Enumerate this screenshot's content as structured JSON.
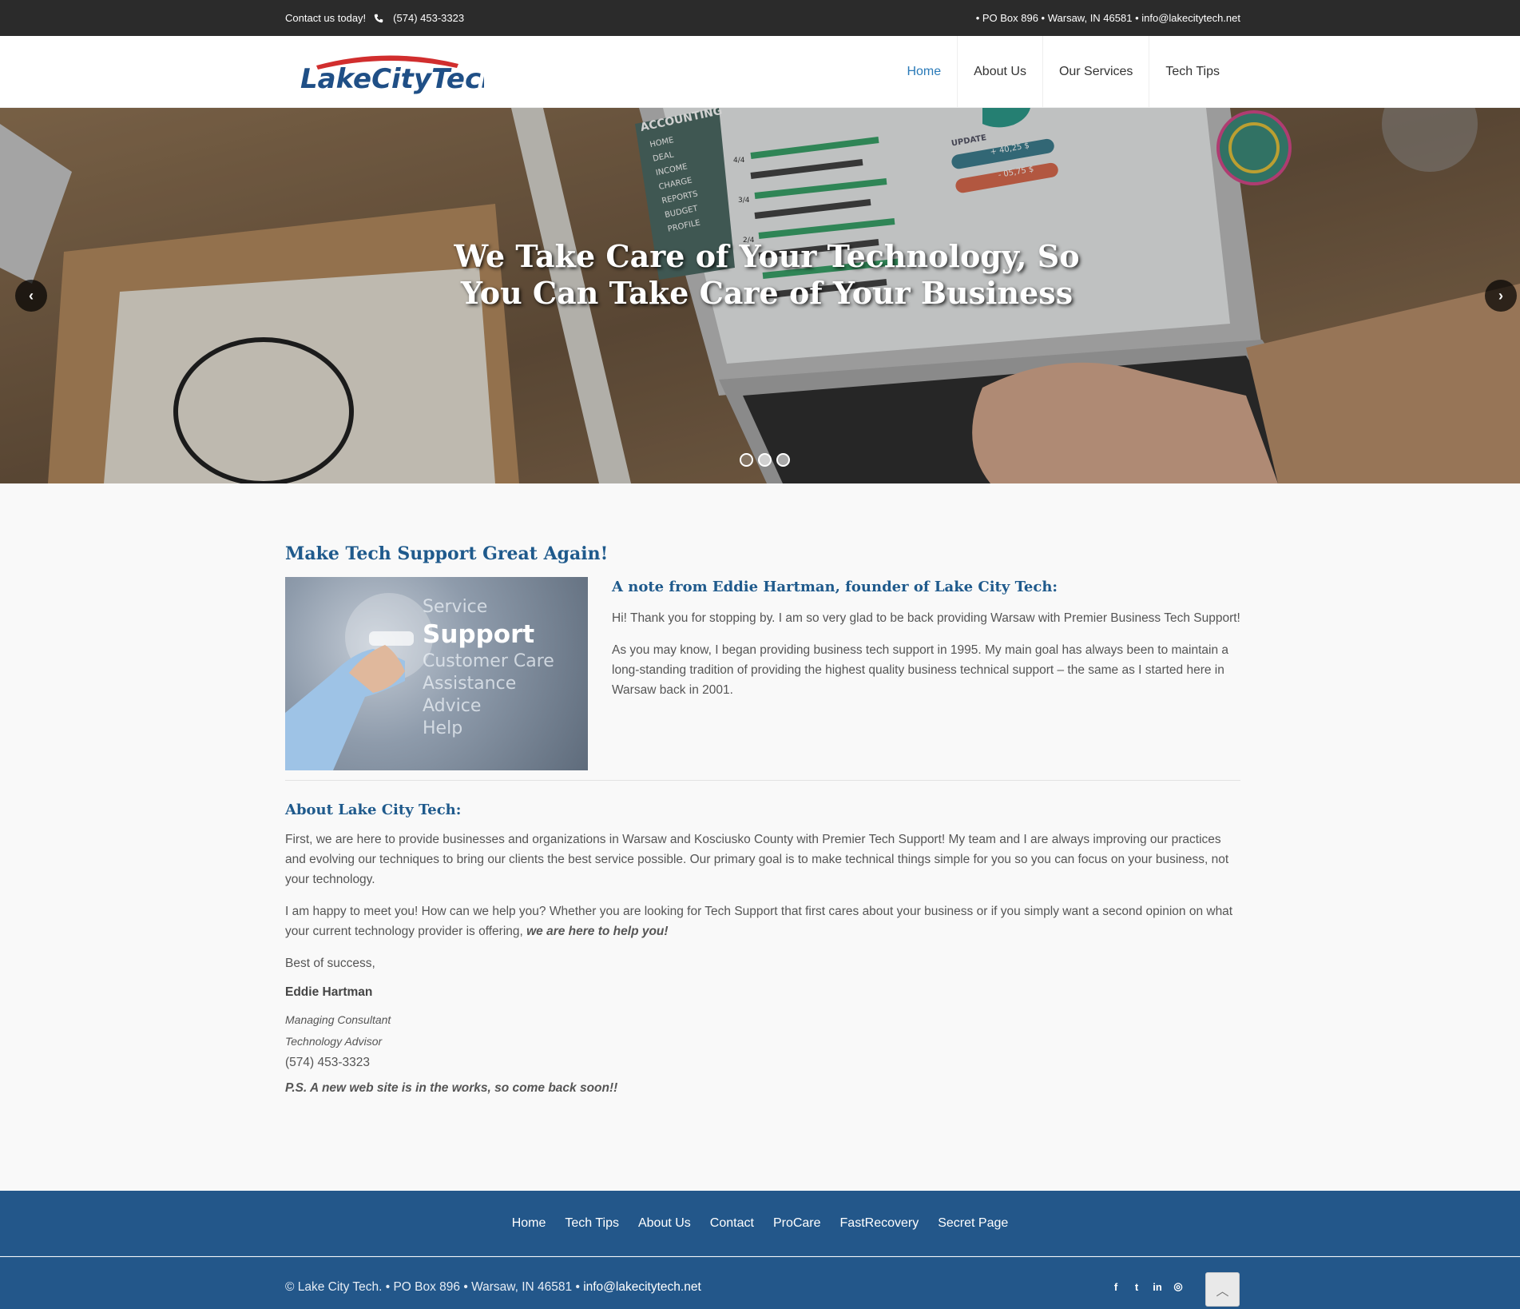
{
  "topbar": {
    "contact_label": "Contact us today!",
    "phone": "(574) 453-3323",
    "address_line": "• PO Box 896 • Warsaw, IN 46581 • info@lakecitytech.net"
  },
  "header": {
    "logo_text": "LakeCityTech",
    "nav": [
      {
        "label": "Home"
      },
      {
        "label": "About Us"
      },
      {
        "label": "Our Services"
      },
      {
        "label": "Tech Tips"
      }
    ]
  },
  "hero": {
    "title": "We Take Care of Your Technology, So You Can Take Care of Your Business",
    "screen_heading": "ACCOUNTING",
    "screen_menu": [
      "HOME",
      "DEAL",
      "INCOME",
      "CHARGE",
      "REPORTS",
      "BUDGET",
      "PROFILE"
    ],
    "screen_update": "UPDATE",
    "screen_update_values": [
      "+ 40,25 $",
      "- 05,75 $"
    ],
    "screen_fractions": [
      "4/4",
      "3/4",
      "2/4"
    ],
    "prev_icon": "‹",
    "next_icon": "›"
  },
  "main": {
    "title": "Make Tech Support Great Again!",
    "image_words": [
      "Service",
      "Support",
      "Customer Care",
      "Assistance",
      "Advice",
      "Help"
    ],
    "note_heading": "A note from Eddie Hartman, founder of Lake City Tech:",
    "note_p1": "Hi! Thank you for stopping by. I am so very glad to be back providing Warsaw with Premier Business Tech Support!",
    "note_p2": "As you may know, I began providing business tech support in 1995. My main goal has always been to maintain a long-standing tradition of providing the highest quality business technical support – the same as I started here in Warsaw back in 2001.",
    "about_heading": "About Lake City Tech:",
    "about_p1": "First, we are here to provide businesses and organizations in Warsaw and Kosciusko County with Premier Tech Support! My team and I are always improving our practices and evolving our techniques to bring our clients the best service possible. Our primary goal is to make technical things simple for you so you can focus on your business, not your technology.",
    "about_p2_start": "I am happy to meet you! How can we help you? Whether you are looking for Tech Support that first cares about your business or if you simply want a second opinion on what your current technology provider is offering, ",
    "about_p2_emphasis": "we are here to help you!",
    "closing": "Best of success,",
    "sig_name": "Eddie Hartman",
    "sig_role1": "Managing Consultant",
    "sig_role2": "Technology Advisor",
    "sig_phone": "(574) 453-3323",
    "ps": "P.S. A new web site is in the works, so come back soon!!"
  },
  "footer": {
    "nav": [
      {
        "label": "Home"
      },
      {
        "label": "Tech Tips"
      },
      {
        "label": "About Us"
      },
      {
        "label": "Contact"
      },
      {
        "label": "ProCare"
      },
      {
        "label": "FastRecovery"
      },
      {
        "label": "Secret Page"
      }
    ],
    "copyright": "© Lake City Tech. • PO Box 896 • Warsaw, IN 46581 • ",
    "email": "info@lakecitytech.net",
    "social": {
      "facebook": "f",
      "twitter": "t",
      "linkedin": "in",
      "instagram": "◎"
    },
    "back_to_top": "︿"
  },
  "colors": {
    "brand_blue": "#1f5a8c",
    "nav_active": "#2a7ab8",
    "footer_bg": "#23578a",
    "topbar_bg": "#2b2b2b"
  }
}
